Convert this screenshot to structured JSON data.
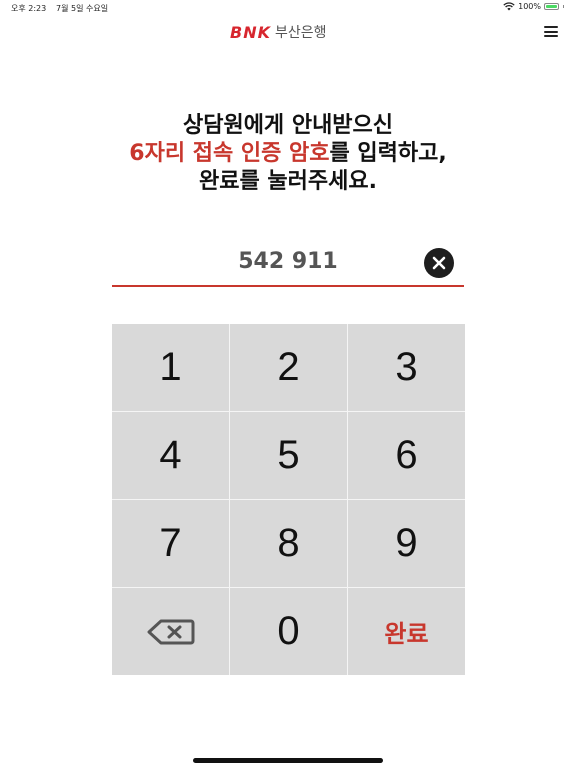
{
  "status_bar": {
    "time": "오후 2:23",
    "date": "7월 5일 수요일",
    "battery": "100%"
  },
  "header": {
    "logo_bnk": "BNK",
    "logo_name": "부산은행"
  },
  "instruction": {
    "line1": "상담원에게 안내받으신",
    "line2_highlight": "6자리 접속 인증 암호",
    "line2_rest": "를 입력하고,",
    "line3": "완료를 눌러주세요."
  },
  "code_field": {
    "value": "542 911"
  },
  "keypad": {
    "keys": [
      "1",
      "2",
      "3",
      "4",
      "5",
      "6",
      "7",
      "8",
      "9",
      "0"
    ],
    "done_label": "완료"
  },
  "colors": {
    "accent": "#c8372d",
    "brand": "#d7262e",
    "key_bg": "#d9d9d9"
  }
}
